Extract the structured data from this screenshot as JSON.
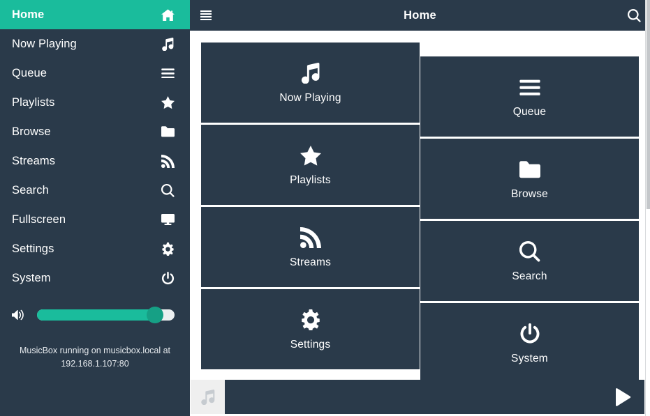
{
  "sidebar": {
    "items": [
      {
        "label": "Home",
        "icon": "home-icon",
        "active": true
      },
      {
        "label": "Now Playing",
        "icon": "music-note-icon",
        "active": false
      },
      {
        "label": "Queue",
        "icon": "list-icon",
        "active": false
      },
      {
        "label": "Playlists",
        "icon": "star-icon",
        "active": false
      },
      {
        "label": "Browse",
        "icon": "folder-icon",
        "active": false
      },
      {
        "label": "Streams",
        "icon": "rss-icon",
        "active": false
      },
      {
        "label": "Search",
        "icon": "search-icon",
        "active": false
      },
      {
        "label": "Fullscreen",
        "icon": "monitor-icon",
        "active": false
      },
      {
        "label": "Settings",
        "icon": "gear-icon",
        "active": false
      },
      {
        "label": "System",
        "icon": "power-icon",
        "active": false
      }
    ],
    "volume": {
      "icon": "volume-icon",
      "value": 86
    },
    "status": "MusicBox running on musicbox.local at 192.168.1.107:80"
  },
  "topbar": {
    "menu_icon": "hamburger-icon",
    "title": "Home",
    "search_icon": "search-icon"
  },
  "main": {
    "left_tiles": [
      {
        "label": "Now Playing",
        "icon": "music-note-icon"
      },
      {
        "label": "Playlists",
        "icon": "star-icon"
      },
      {
        "label": "Streams",
        "icon": "rss-icon"
      },
      {
        "label": "Settings",
        "icon": "gear-icon"
      }
    ],
    "right_tiles": [
      {
        "label": "Queue",
        "icon": "list-icon"
      },
      {
        "label": "Browse",
        "icon": "folder-icon"
      },
      {
        "label": "Search",
        "icon": "search-icon"
      },
      {
        "label": "System",
        "icon": "power-icon"
      }
    ]
  },
  "player": {
    "albumart_icon": "music-note-icon",
    "play_icon": "play-icon"
  },
  "colors": {
    "accent": "#1abc9c",
    "accent_dark": "#16a085",
    "panel": "#2a3a4a",
    "background": "#ffffff",
    "albumart": "#efefef"
  }
}
